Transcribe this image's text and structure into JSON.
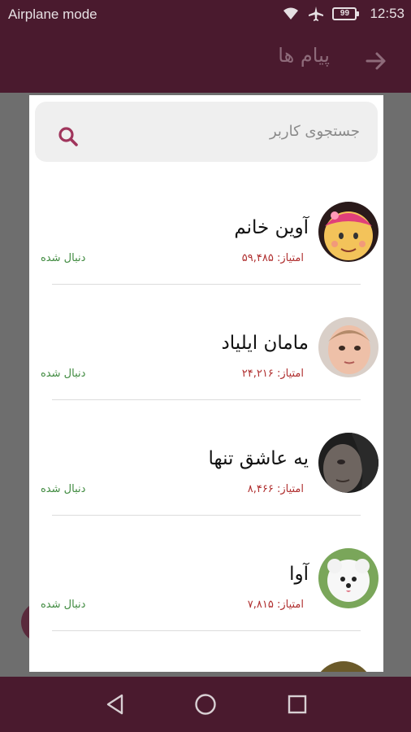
{
  "status_bar": {
    "mode_label": "Airplane mode",
    "battery": "99",
    "time": "12:53",
    "icons": [
      "wifi-icon",
      "airplane-icon",
      "battery-icon"
    ]
  },
  "app_bar": {
    "title": "پیام ها",
    "back_icon": "arrow-right-icon"
  },
  "search": {
    "placeholder": "جستجوی کاربر",
    "icon": "search-icon"
  },
  "users": [
    {
      "name": "آوین خانم",
      "score": "امتیاز: ۵۹,۴۸۵",
      "status": "دنبال شده",
      "avatar": "cartoon-girl-avatar"
    },
    {
      "name": "مامان ایلیاد",
      "score": "امتیاز: ۲۴,۲۱۶",
      "status": "دنبال شده",
      "avatar": "baby-photo-avatar"
    },
    {
      "name": "یه عاشق تنها",
      "score": "امتیاز: ۸,۴۶۶",
      "status": "دنبال شده",
      "avatar": "dark-portrait-avatar"
    },
    {
      "name": "آوا",
      "score": "امتیاز: ۷,۸۱۵",
      "status": "دنبال شده",
      "avatar": "white-puppy-avatar"
    }
  ],
  "nav_bar": {
    "icons": [
      "back-triangle-icon",
      "home-circle-icon",
      "recents-square-icon"
    ]
  },
  "colors": {
    "primary_dark": "#4a1a2e",
    "score_red": "#b03030",
    "follow_green": "#3f8a3f",
    "accent": "#a0355c"
  }
}
